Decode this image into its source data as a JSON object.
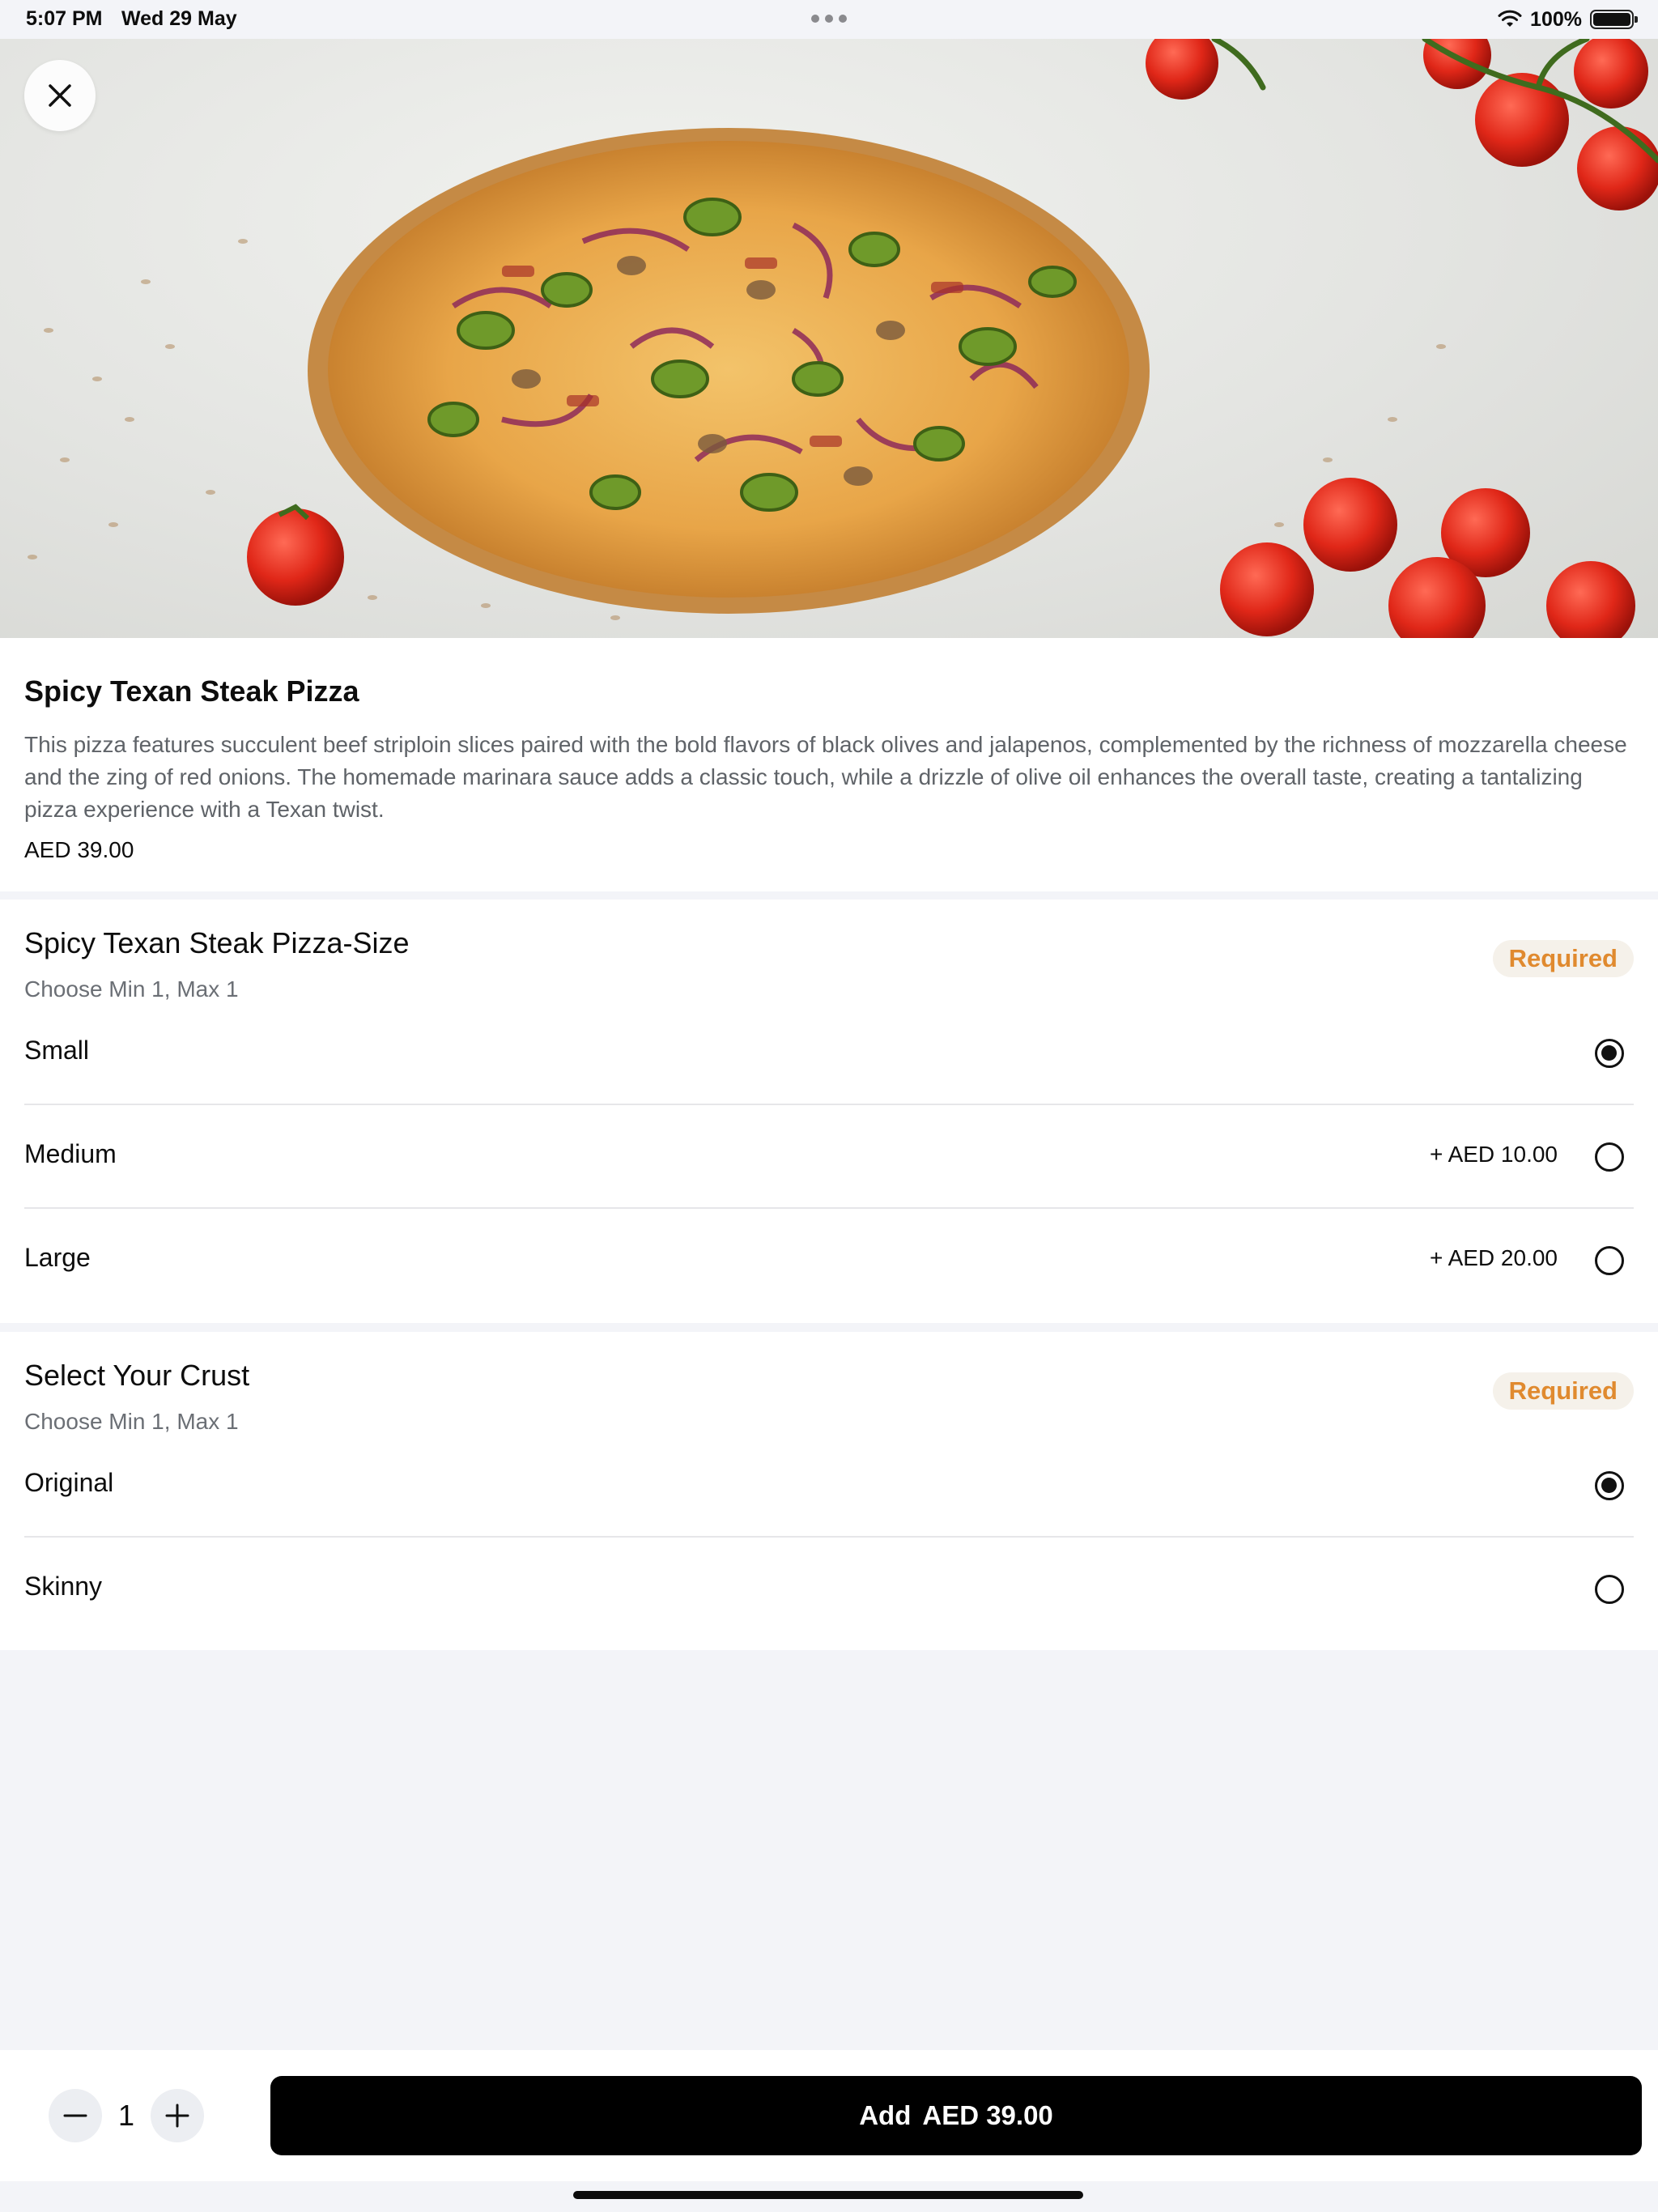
{
  "status_bar": {
    "time": "5:07 PM",
    "date": "Wed 29 May",
    "battery": "100%"
  },
  "hero": {
    "image_alt": "Spicy Texan Steak Pizza photo",
    "close_icon": "close-icon"
  },
  "product": {
    "title": "Spicy Texan Steak Pizza",
    "description": "This pizza features succulent beef striploin slices paired with the bold flavors of black olives and jalapenos, complemented by the richness of mozzarella cheese and the zing of red onions. The homemade marinara sauce adds a classic touch, while a drizzle of olive oil enhances the overall taste, creating a tantalizing pizza experience with a Texan twist.",
    "price": "AED 39.00"
  },
  "size_group": {
    "title": "Spicy Texan Steak Pizza-Size",
    "subtitle": "Choose Min 1, Max 1",
    "badge": "Required",
    "options": [
      {
        "label": "Small",
        "price": "",
        "selected": true
      },
      {
        "label": "Medium",
        "price": "+ AED 10.00",
        "selected": false
      },
      {
        "label": "Large",
        "price": "+ AED 20.00",
        "selected": false
      }
    ]
  },
  "crust_group": {
    "title": "Select Your Crust",
    "subtitle": "Choose Min 1, Max 1",
    "badge": "Required",
    "options": [
      {
        "label": "Original",
        "price": "",
        "selected": true
      },
      {
        "label": "Skinny",
        "price": "",
        "selected": false
      }
    ]
  },
  "bottom_bar": {
    "quantity": "1",
    "add_label": "Add",
    "add_price": "AED 39.00"
  },
  "colors": {
    "accent": "#e08a2f",
    "button": "#000000",
    "background": "#f3f4f8"
  }
}
